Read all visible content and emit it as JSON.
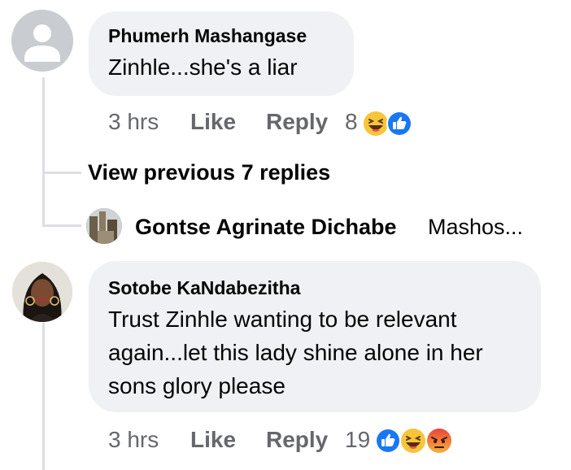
{
  "comment1": {
    "author": "Phumerh Mashangase",
    "text": "Zinhle...she's a liar",
    "time": "3 hrs",
    "like_label": "Like",
    "reply_label": "Reply",
    "reaction_count": "8",
    "reactions": [
      "haha-icon",
      "like-icon"
    ]
  },
  "thread": {
    "view_previous": "View previous 7 replies",
    "reply_author": "Gontse Agrinate Dichabe",
    "reply_snippet": "Mashos..."
  },
  "comment2": {
    "author": "Sotobe KaNdabezitha",
    "text_lines": [
      "Trust Zinhle wanting to be relevant",
      "again...let this lady shine alone in her",
      "sons glory please"
    ],
    "time": "3 hrs",
    "like_label": "Like",
    "reply_label": "Reply",
    "reaction_count": "19",
    "reactions": [
      "like-icon",
      "haha-icon",
      "angry-icon"
    ]
  },
  "colors": {
    "bubble": "#eff1f4",
    "meta_text": "#65676b",
    "like_blue": "#1877f2",
    "haha_yellow": "#f7c53b",
    "angry_orange": "#e9713a"
  }
}
